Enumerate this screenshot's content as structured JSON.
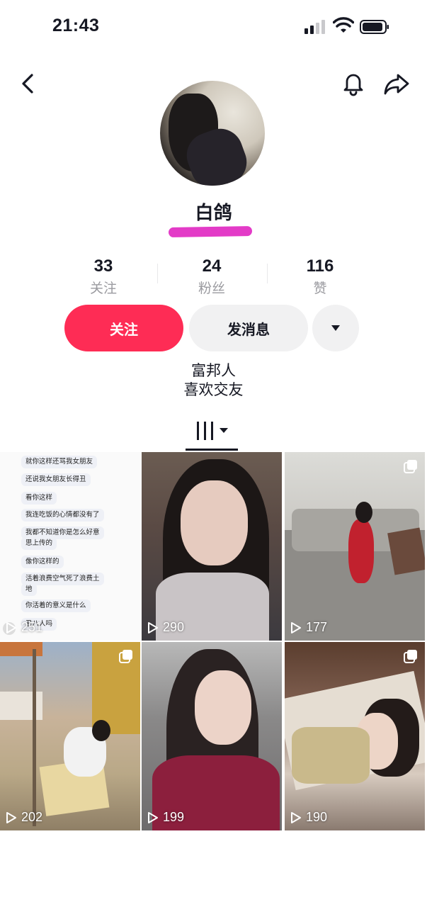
{
  "status_bar": {
    "time": "21:43"
  },
  "profile": {
    "username": "白鸽",
    "stats": [
      {
        "value": "33",
        "label": "关注"
      },
      {
        "value": "24",
        "label": "粉丝"
      },
      {
        "value": "116",
        "label": "赞"
      }
    ],
    "follow_label": "关注",
    "message_label": "发消息",
    "bio_lines": [
      "富邦人",
      "喜欢交友"
    ]
  },
  "colors": {
    "accent": "#fe2c55",
    "button_gray": "#f1f1f2",
    "redaction": "#e33bc7"
  },
  "chat_lines": [
    "就你这样还骂我女朋友",
    "还说我女朋友长得丑",
    "看你这样",
    "我连吃饭的心情都没有了",
    "我都不知道你是怎么好意",
    "思上传的",
    "像你这样的",
    "活着浪费空气死了浪费土",
    "地",
    "你活着的意义是什么",
    "丑八人吗"
  ],
  "videos": [
    {
      "views": "251",
      "multi": false
    },
    {
      "views": "290",
      "multi": false
    },
    {
      "views": "177",
      "multi": true
    },
    {
      "views": "202",
      "multi": true
    },
    {
      "views": "199",
      "multi": false
    },
    {
      "views": "190",
      "multi": true
    }
  ]
}
